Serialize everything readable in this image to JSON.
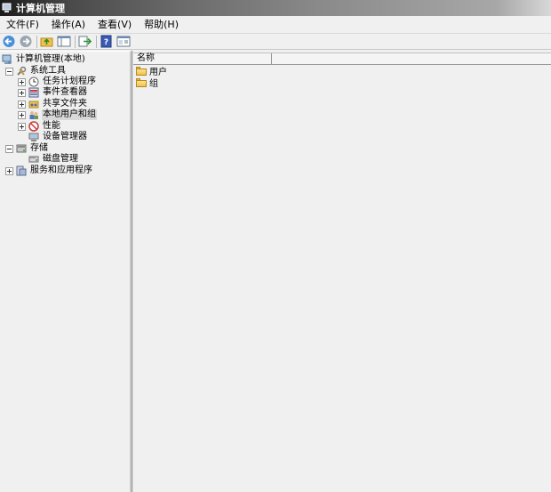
{
  "window": {
    "title": "计算机管理"
  },
  "menu": [
    {
      "label": "文件(F)"
    },
    {
      "label": "操作(A)"
    },
    {
      "label": "查看(V)"
    },
    {
      "label": "帮助(H)"
    }
  ],
  "toolbar": {
    "buttons": [
      "back-icon",
      "forward-icon",
      "up-folder-icon",
      "show-tree-icon",
      "export-icon",
      "help-icon",
      "properties-icon"
    ]
  },
  "tree": {
    "root": "计算机管理(本地)",
    "system_tools": "系统工具",
    "task_scheduler": "任务计划程序",
    "event_viewer": "事件查看器",
    "shared_folders": "共享文件夹",
    "local_users_groups": "本地用户和组",
    "performance": "性能",
    "device_manager": "设备管理器",
    "storage": "存储",
    "disk_management": "磁盘管理",
    "services_apps": "服务和应用程序"
  },
  "list": {
    "column_name": "名称",
    "items": [
      "用户",
      "组"
    ]
  },
  "colors": {
    "title_bar": "#1b1b1b",
    "selection": "#d8d8d8",
    "folder": "#f0c24b"
  }
}
